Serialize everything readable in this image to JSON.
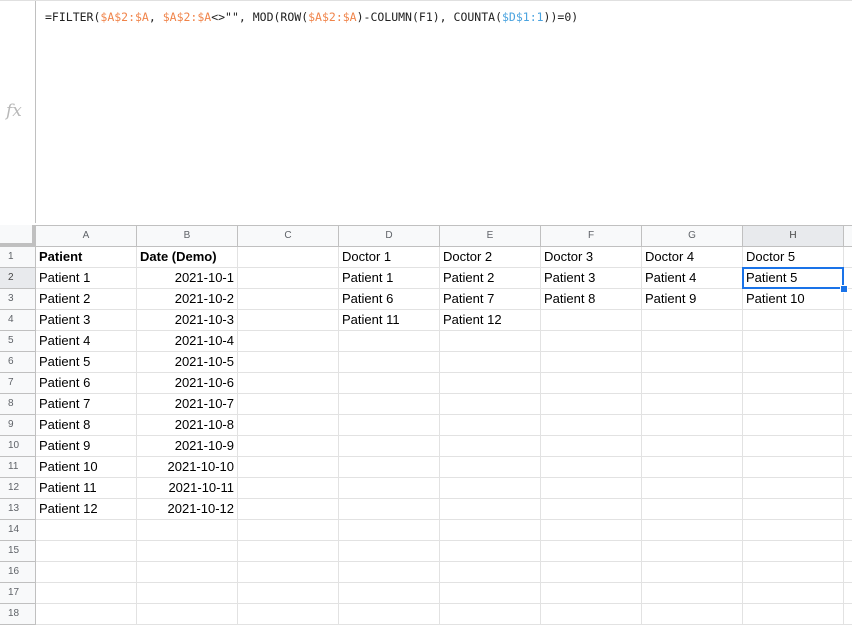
{
  "formula_bar": {
    "fx_label": "fx",
    "formula_parts": [
      {
        "text": "=FILTER(",
        "style": "plain"
      },
      {
        "text": "$A$2:$A",
        "style": "orange"
      },
      {
        "text": ", ",
        "style": "plain"
      },
      {
        "text": "$A$2:$A",
        "style": "orange"
      },
      {
        "text": "<>\"\", MOD(ROW(",
        "style": "plain"
      },
      {
        "text": "$A$2:$A",
        "style": "orange"
      },
      {
        "text": ")-COLUMN(F1), COUNTA(",
        "style": "plain"
      },
      {
        "text": "$D$1:1",
        "style": "blue"
      },
      {
        "text": "))=0)",
        "style": "plain"
      }
    ]
  },
  "sheet": {
    "columns": [
      "A",
      "B",
      "C",
      "D",
      "E",
      "F",
      "G",
      "H"
    ],
    "rows": [
      "1",
      "2",
      "3",
      "4",
      "5",
      "6",
      "7",
      "8",
      "9",
      "10",
      "11",
      "12",
      "13",
      "14",
      "15",
      "16",
      "17",
      "18"
    ],
    "selected_cell": "H2",
    "cells": {
      "A": [
        "Patient",
        "Patient 1",
        "Patient 2",
        "Patient 3",
        "Patient 4",
        "Patient 5",
        "Patient 6",
        "Patient 7",
        "Patient 8",
        "Patient 9",
        "Patient 10",
        "Patient 11",
        "Patient 12"
      ],
      "B": [
        "Date (Demo)",
        "2021-10-1",
        "2021-10-2",
        "2021-10-3",
        "2021-10-4",
        "2021-10-5",
        "2021-10-6",
        "2021-10-7",
        "2021-10-8",
        "2021-10-9",
        "2021-10-10",
        "2021-10-11",
        "2021-10-12"
      ],
      "D": [
        "Doctor 1",
        "Patient 1",
        "Patient 6",
        "Patient 11"
      ],
      "E": [
        "Doctor 2",
        "Patient 2",
        "Patient 7",
        "Patient 12"
      ],
      "F": [
        "Doctor 3",
        "Patient 3",
        "Patient 8"
      ],
      "G": [
        "Doctor 4",
        "Patient 4",
        "Patient 9"
      ],
      "H": [
        "Doctor 5",
        "Patient 5",
        "Patient 10"
      ]
    }
  },
  "colors": {
    "selection": "#1a73e8",
    "range_ref_orange": "#f0844a",
    "range_ref_blue": "#4aa3df"
  }
}
